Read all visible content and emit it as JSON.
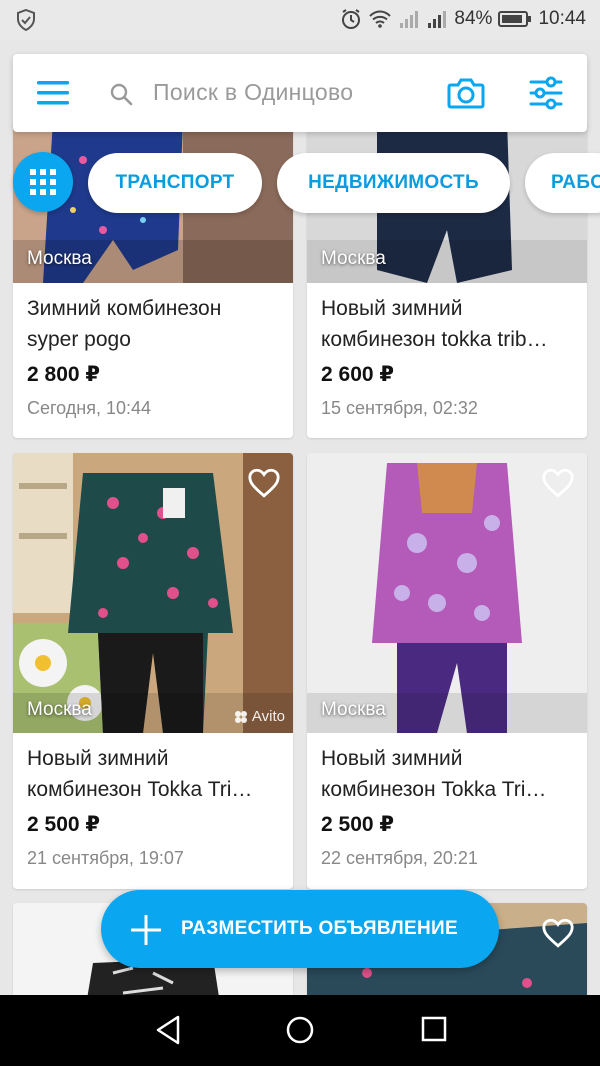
{
  "status_bar": {
    "battery": "84%",
    "time": "10:44"
  },
  "search": {
    "placeholder": "Поиск в Одинцово"
  },
  "categories": [
    "ТРАНСПОРТ",
    "НЕДВИЖИМОСТЬ",
    "РАБО"
  ],
  "listings": [
    {
      "location": "Москва",
      "title_line1": "Зимний комбинезон",
      "title_line2": "syper pogo",
      "price": "2 800 ₽",
      "date": "Сегодня, 10:44"
    },
    {
      "location": "Москва",
      "title_line1": "Новый зимний",
      "title_line2": "комбинезон tokka trib…",
      "price": "2 600 ₽",
      "date": "15 сентября, 02:32"
    },
    {
      "location": "Москва",
      "title_line1": "Новый зимний",
      "title_line2": "комбинезон Tokka Tri…",
      "price": "2 500 ₽",
      "date": "21 сентября, 19:07",
      "watermark": "Avito"
    },
    {
      "location": "Москва",
      "title_line1": "Новый зимний",
      "title_line2": "комбинезон Tokka Tri…",
      "price": "2 500 ₽",
      "date": "22 сентября, 20:21"
    }
  ],
  "fab": {
    "label": "РАЗМЕСТИТЬ ОБЪЯВЛЕНИЕ"
  },
  "colors": {
    "accent": "#0aa6f0",
    "background": "#e7e7e7"
  },
  "icons": [
    "shield-icon",
    "alarm-icon",
    "wifi-icon",
    "signal-icon",
    "battery-icon",
    "menu-icon",
    "search-icon",
    "camera-icon",
    "filter-icon",
    "grid-icon",
    "heart-icon",
    "plus-icon",
    "back-icon",
    "home-icon",
    "recents-icon"
  ]
}
